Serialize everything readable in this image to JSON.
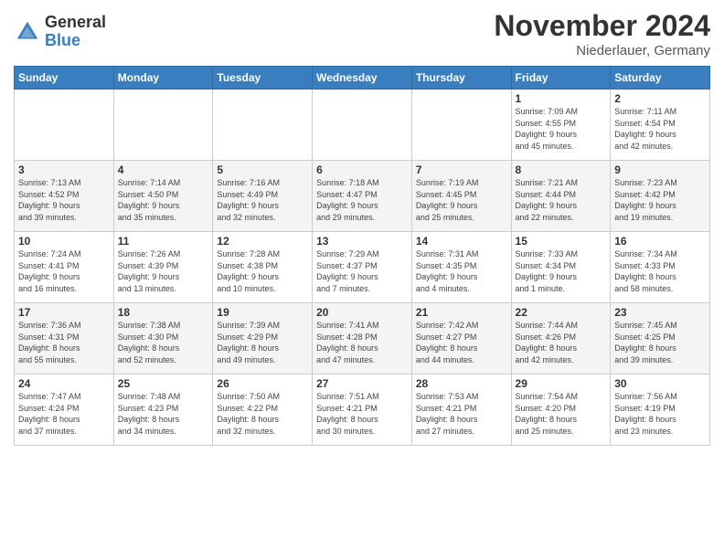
{
  "header": {
    "logo_general": "General",
    "logo_blue": "Blue",
    "title": "November 2024",
    "location": "Niederlauer, Germany"
  },
  "days_of_week": [
    "Sunday",
    "Monday",
    "Tuesday",
    "Wednesday",
    "Thursday",
    "Friday",
    "Saturday"
  ],
  "weeks": [
    [
      {
        "day": "",
        "info": ""
      },
      {
        "day": "",
        "info": ""
      },
      {
        "day": "",
        "info": ""
      },
      {
        "day": "",
        "info": ""
      },
      {
        "day": "",
        "info": ""
      },
      {
        "day": "1",
        "info": "Sunrise: 7:09 AM\nSunset: 4:55 PM\nDaylight: 9 hours\nand 45 minutes."
      },
      {
        "day": "2",
        "info": "Sunrise: 7:11 AM\nSunset: 4:54 PM\nDaylight: 9 hours\nand 42 minutes."
      }
    ],
    [
      {
        "day": "3",
        "info": "Sunrise: 7:13 AM\nSunset: 4:52 PM\nDaylight: 9 hours\nand 39 minutes."
      },
      {
        "day": "4",
        "info": "Sunrise: 7:14 AM\nSunset: 4:50 PM\nDaylight: 9 hours\nand 35 minutes."
      },
      {
        "day": "5",
        "info": "Sunrise: 7:16 AM\nSunset: 4:49 PM\nDaylight: 9 hours\nand 32 minutes."
      },
      {
        "day": "6",
        "info": "Sunrise: 7:18 AM\nSunset: 4:47 PM\nDaylight: 9 hours\nand 29 minutes."
      },
      {
        "day": "7",
        "info": "Sunrise: 7:19 AM\nSunset: 4:45 PM\nDaylight: 9 hours\nand 25 minutes."
      },
      {
        "day": "8",
        "info": "Sunrise: 7:21 AM\nSunset: 4:44 PM\nDaylight: 9 hours\nand 22 minutes."
      },
      {
        "day": "9",
        "info": "Sunrise: 7:23 AM\nSunset: 4:42 PM\nDaylight: 9 hours\nand 19 minutes."
      }
    ],
    [
      {
        "day": "10",
        "info": "Sunrise: 7:24 AM\nSunset: 4:41 PM\nDaylight: 9 hours\nand 16 minutes."
      },
      {
        "day": "11",
        "info": "Sunrise: 7:26 AM\nSunset: 4:39 PM\nDaylight: 9 hours\nand 13 minutes."
      },
      {
        "day": "12",
        "info": "Sunrise: 7:28 AM\nSunset: 4:38 PM\nDaylight: 9 hours\nand 10 minutes."
      },
      {
        "day": "13",
        "info": "Sunrise: 7:29 AM\nSunset: 4:37 PM\nDaylight: 9 hours\nand 7 minutes."
      },
      {
        "day": "14",
        "info": "Sunrise: 7:31 AM\nSunset: 4:35 PM\nDaylight: 9 hours\nand 4 minutes."
      },
      {
        "day": "15",
        "info": "Sunrise: 7:33 AM\nSunset: 4:34 PM\nDaylight: 9 hours\nand 1 minute."
      },
      {
        "day": "16",
        "info": "Sunrise: 7:34 AM\nSunset: 4:33 PM\nDaylight: 8 hours\nand 58 minutes."
      }
    ],
    [
      {
        "day": "17",
        "info": "Sunrise: 7:36 AM\nSunset: 4:31 PM\nDaylight: 8 hours\nand 55 minutes."
      },
      {
        "day": "18",
        "info": "Sunrise: 7:38 AM\nSunset: 4:30 PM\nDaylight: 8 hours\nand 52 minutes."
      },
      {
        "day": "19",
        "info": "Sunrise: 7:39 AM\nSunset: 4:29 PM\nDaylight: 8 hours\nand 49 minutes."
      },
      {
        "day": "20",
        "info": "Sunrise: 7:41 AM\nSunset: 4:28 PM\nDaylight: 8 hours\nand 47 minutes."
      },
      {
        "day": "21",
        "info": "Sunrise: 7:42 AM\nSunset: 4:27 PM\nDaylight: 8 hours\nand 44 minutes."
      },
      {
        "day": "22",
        "info": "Sunrise: 7:44 AM\nSunset: 4:26 PM\nDaylight: 8 hours\nand 42 minutes."
      },
      {
        "day": "23",
        "info": "Sunrise: 7:45 AM\nSunset: 4:25 PM\nDaylight: 8 hours\nand 39 minutes."
      }
    ],
    [
      {
        "day": "24",
        "info": "Sunrise: 7:47 AM\nSunset: 4:24 PM\nDaylight: 8 hours\nand 37 minutes."
      },
      {
        "day": "25",
        "info": "Sunrise: 7:48 AM\nSunset: 4:23 PM\nDaylight: 8 hours\nand 34 minutes."
      },
      {
        "day": "26",
        "info": "Sunrise: 7:50 AM\nSunset: 4:22 PM\nDaylight: 8 hours\nand 32 minutes."
      },
      {
        "day": "27",
        "info": "Sunrise: 7:51 AM\nSunset: 4:21 PM\nDaylight: 8 hours\nand 30 minutes."
      },
      {
        "day": "28",
        "info": "Sunrise: 7:53 AM\nSunset: 4:21 PM\nDaylight: 8 hours\nand 27 minutes."
      },
      {
        "day": "29",
        "info": "Sunrise: 7:54 AM\nSunset: 4:20 PM\nDaylight: 8 hours\nand 25 minutes."
      },
      {
        "day": "30",
        "info": "Sunrise: 7:56 AM\nSunset: 4:19 PM\nDaylight: 8 hours\nand 23 minutes."
      }
    ]
  ]
}
